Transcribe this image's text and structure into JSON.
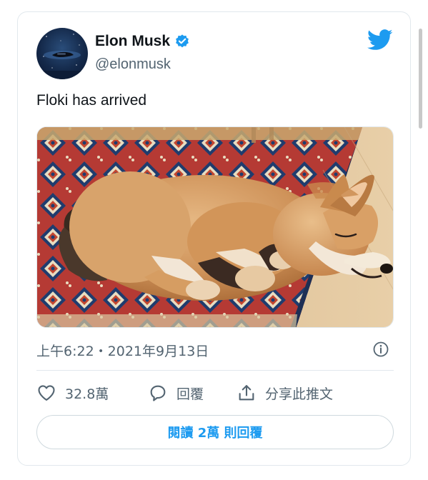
{
  "colors": {
    "accent": "#1d9bf0",
    "text_primary": "#0f1419",
    "text_secondary": "#536471",
    "border": "#e1e8ed"
  },
  "author": {
    "name": "Elon Musk",
    "handle": "@elonmusk",
    "verified_icon": "verified-badge-icon",
    "avatar": "profile-avatar"
  },
  "brand": {
    "icon": "twitter-bird-icon"
  },
  "tweet": {
    "text": "Floki has arrived",
    "media": "photo-shiba-inu-puppy-sleeping-on-rug",
    "timestamp": "上午6:22・2021年9月13日"
  },
  "actions": {
    "like": {
      "icon": "heart-icon",
      "label": "32.8萬"
    },
    "reply": {
      "icon": "speech-bubble-icon",
      "label": "回覆"
    },
    "share": {
      "icon": "share-upload-icon",
      "label": "分享此推文"
    }
  },
  "info_icon": "info-icon",
  "read_replies_label": "閱讀 2萬 則回覆"
}
